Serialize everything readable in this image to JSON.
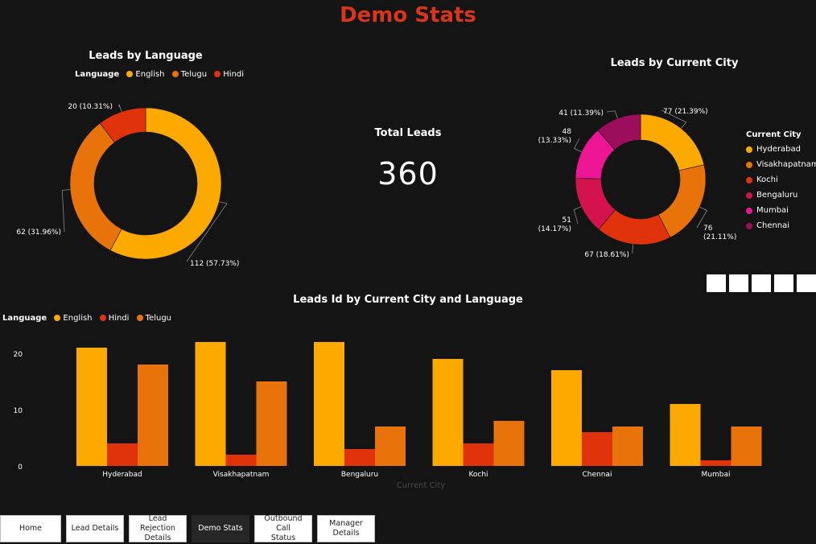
{
  "page": {
    "title": "Demo Stats"
  },
  "kpi": {
    "label": "Total Leads",
    "value": "360"
  },
  "colors": {
    "english": "#fdaa00",
    "telugu": "#e8730a",
    "hindi": "#e0330c",
    "hyderabad": "#fdaa00",
    "visakhapatnam": "#e8730a",
    "kochi": "#e0330c",
    "bengaluru": "#d4134e",
    "mumbai": "#ec1593",
    "chennai": "#9c0e5c"
  },
  "language_chart": {
    "title": "Leads by Language",
    "legend_title": "Language",
    "legend": [
      "English",
      "Telugu",
      "Hindi"
    ],
    "data_labels": [
      "112 (57.73%)",
      "62 (31.96%)",
      "20 (10.31%)"
    ]
  },
  "city_chart": {
    "title": "Leads by Current City",
    "legend_title": "Current City",
    "legend": [
      "Hyderabad",
      "Visakhapatnam",
      "Kochi",
      "Bengaluru",
      "Mumbai",
      "Chennai"
    ],
    "data_labels": [
      [
        "77 (21.39%)"
      ],
      [
        "76",
        "(21.11%)"
      ],
      [
        "67 (18.61%)"
      ],
      [
        "51",
        "(14.17%)"
      ],
      [
        "48",
        "(13.33%)"
      ],
      [
        "41 (11.39%)"
      ]
    ]
  },
  "bar_chart": {
    "title": "Leads Id by Current City and Language",
    "legend_title": "Language",
    "legend": [
      "English",
      "Hindi",
      "Telugu"
    ],
    "xlabel": "Current City",
    "yticks": [
      "0",
      "10",
      "20"
    ]
  },
  "nav": {
    "buttons": [
      {
        "label": [
          "Home"
        ],
        "active": false
      },
      {
        "label": [
          "Lead Details"
        ],
        "active": false
      },
      {
        "label": [
          "Lead Rejection",
          "Details"
        ],
        "active": false
      },
      {
        "label": [
          "Demo Stats"
        ],
        "active": true
      },
      {
        "label": [
          "Outbound Call",
          "Status"
        ],
        "active": false
      },
      {
        "label": [
          "Manager Details"
        ],
        "active": false
      }
    ]
  },
  "chart_data": [
    {
      "type": "pie",
      "title": "Leads by Language",
      "categories": [
        "English",
        "Telugu",
        "Hindi"
      ],
      "values": [
        112,
        62,
        20
      ],
      "donut": true,
      "legend_position": "top"
    },
    {
      "type": "pie",
      "title": "Leads by Current City",
      "categories": [
        "Hyderabad",
        "Visakhapatnam",
        "Kochi",
        "Bengaluru",
        "Mumbai",
        "Chennai"
      ],
      "values": [
        77,
        76,
        67,
        51,
        48,
        41
      ],
      "donut": true,
      "legend_position": "right"
    },
    {
      "type": "bar",
      "title": "Leads Id by Current City and Language",
      "categories": [
        "Hyderabad",
        "Visakhapatnam",
        "Bengaluru",
        "Kochi",
        "Chennai",
        "Mumbai"
      ],
      "series": [
        {
          "name": "English",
          "values": [
            21,
            22,
            22,
            19,
            17,
            11
          ]
        },
        {
          "name": "Hindi",
          "values": [
            4,
            2,
            3,
            4,
            6,
            1
          ]
        },
        {
          "name": "Telugu",
          "values": [
            18,
            15,
            7,
            8,
            7,
            7
          ]
        }
      ],
      "xlabel": "Current City",
      "ylabel": "",
      "ylim": [
        0,
        23
      ],
      "grid": false,
      "legend_position": "top-left"
    }
  ]
}
